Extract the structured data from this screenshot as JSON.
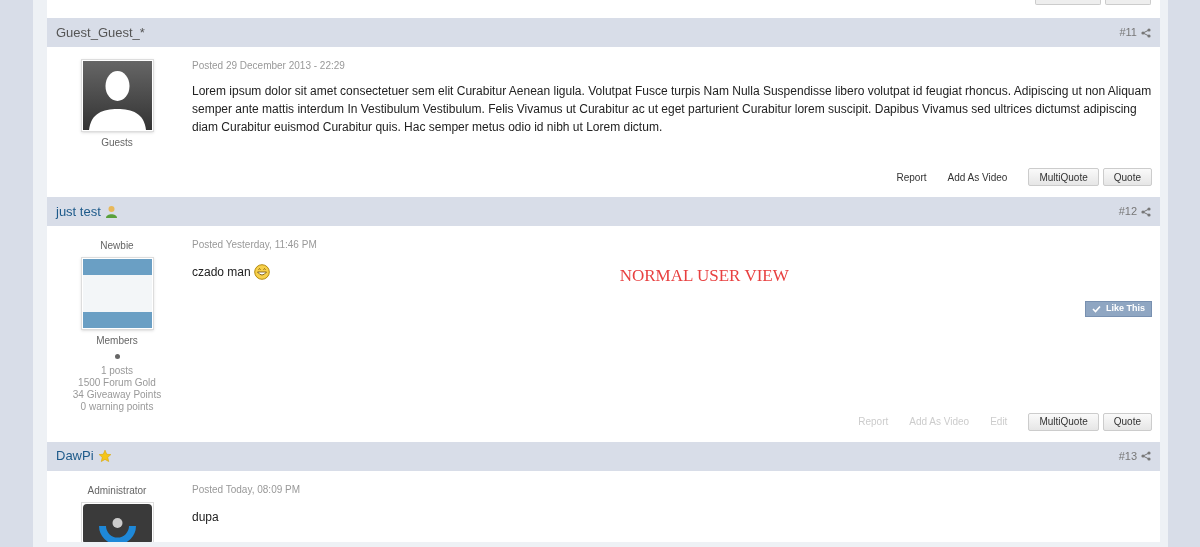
{
  "posts": [
    {
      "author": "Guest_Guest_*",
      "number": "#11",
      "avatar": {
        "kind": "silhouette"
      },
      "group": "Guests",
      "posted": "Posted 29 December 2013 - 22:29",
      "body": "Lorem ipsum dolor sit amet consectetuer sem elit Curabitur Aenean ligula. Volutpat Fusce turpis Nam Nulla Suspendisse libero volutpat id feugiat rhoncus. Adipiscing ut non Aliquam semper ante mattis interdum In Vestibulum Vestibulum. Felis Vivamus ut Curabitur ac ut eget parturient Curabitur lorem suscipit. Dapibus Vivamus sed ultrices dictumst adipiscing diam Curabitur euismod Curabitur quis. Hac semper metus odio id nibh ut Lorem dictum.",
      "actions": [
        {
          "kind": "link",
          "label": "Report",
          "disabled": false
        },
        {
          "kind": "link",
          "label": "Add As Video",
          "disabled": false
        },
        {
          "kind": "button",
          "label": "MultiQuote",
          "disabled": false
        },
        {
          "kind": "button",
          "label": "Quote",
          "disabled": false
        }
      ]
    },
    {
      "author": "just test",
      "badge": {
        "kind": "member"
      },
      "number": "#12",
      "rank": "Newbie",
      "avatar": {
        "kind": "banner"
      },
      "group": "Members",
      "online": false,
      "stats": [
        "1 posts",
        "1500 Forum Gold",
        "34 Giveaway Points",
        "0 warning points"
      ],
      "posted": "Posted Yesterday, 11:46 PM",
      "body": "czado man",
      "smiley": true,
      "note": "NORMAL USER VIEW",
      "like_button": "Like This",
      "actions": [
        {
          "kind": "link",
          "label": "Report",
          "disabled": true
        },
        {
          "kind": "link",
          "label": "Add As Video",
          "disabled": true
        },
        {
          "kind": "link",
          "label": "Edit",
          "disabled": true
        },
        {
          "kind": "button",
          "label": "MultiQuote",
          "disabled": false
        },
        {
          "kind": "button",
          "label": "Quote",
          "disabled": false
        }
      ]
    },
    {
      "author": "DawPi",
      "badge": {
        "kind": "star"
      },
      "number": "#13",
      "rank": "Administrator",
      "avatar": {
        "kind": "admin"
      },
      "posted": "Posted Today, 08:09 PM",
      "body": "dupa"
    }
  ]
}
